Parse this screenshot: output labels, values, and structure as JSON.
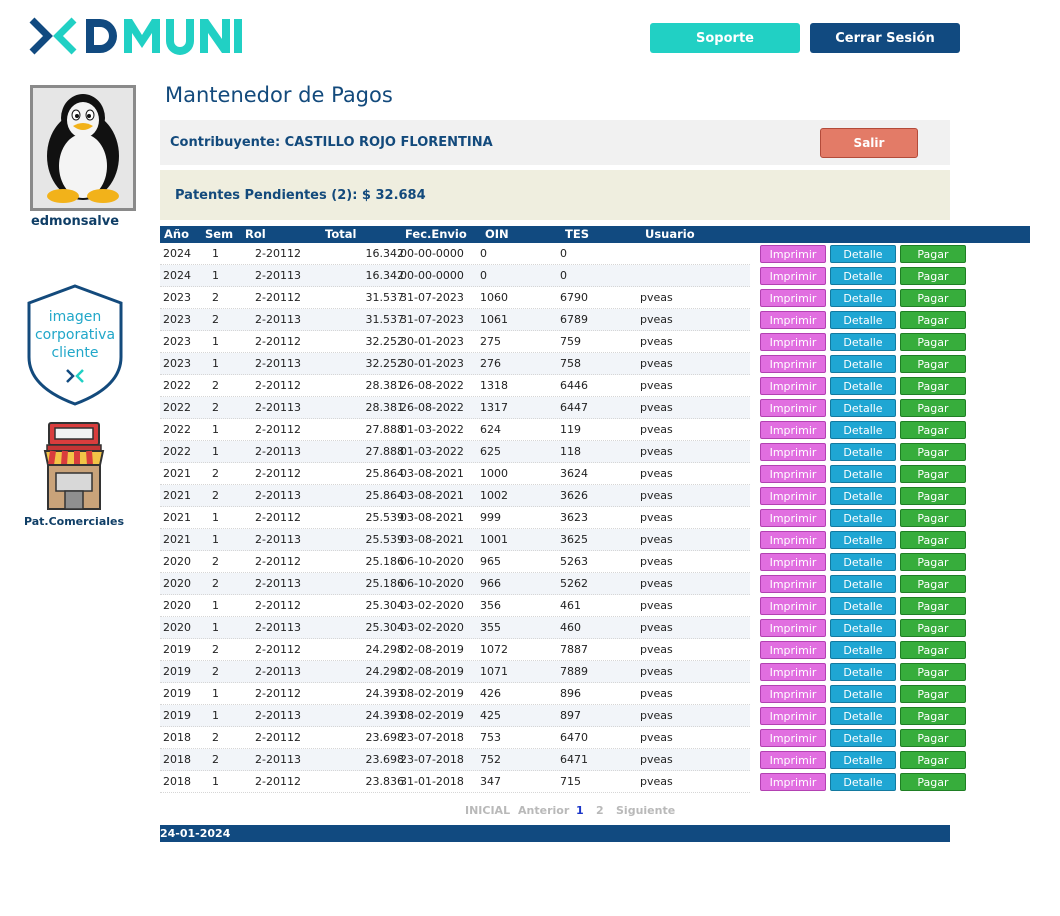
{
  "brand": {
    "logo_text": "DMUNI",
    "colors": {
      "teal": "#21d0c4",
      "navy": "#114a80"
    }
  },
  "header": {
    "support_label": "Soporte",
    "logout_label": "Cerrar Sesión"
  },
  "sidebar": {
    "username": "edmonsalve",
    "corp_image_lines": [
      "imagen",
      "corporativa",
      "cliente"
    ],
    "commercial_label": "Pat.Comerciales"
  },
  "page": {
    "title": "Mantenedor de Pagos",
    "contribuyente": "Contribuyente: CASTILLO ROJO FLORENTINA",
    "exit_label": "Salir",
    "pending": "Patentes Pendientes (2): $ 32.684"
  },
  "table": {
    "columns": [
      "Año",
      "Sem",
      "Rol",
      "Total",
      "Fec.Envio",
      "OIN",
      "TES",
      "Usuario"
    ],
    "action_labels": {
      "print": "Imprimir",
      "detail": "Detalle",
      "pay": "Pagar"
    },
    "rows": [
      [
        "2024",
        "1",
        "2-20112",
        "16.342",
        "00-00-0000",
        "0",
        "0",
        ""
      ],
      [
        "2024",
        "1",
        "2-20113",
        "16.342",
        "00-00-0000",
        "0",
        "0",
        ""
      ],
      [
        "2023",
        "2",
        "2-20112",
        "31.537",
        "31-07-2023",
        "1060",
        "6790",
        "pveas"
      ],
      [
        "2023",
        "2",
        "2-20113",
        "31.537",
        "31-07-2023",
        "1061",
        "6789",
        "pveas"
      ],
      [
        "2023",
        "1",
        "2-20112",
        "32.252",
        "30-01-2023",
        "275",
        "759",
        "pveas"
      ],
      [
        "2023",
        "1",
        "2-20113",
        "32.252",
        "30-01-2023",
        "276",
        "758",
        "pveas"
      ],
      [
        "2022",
        "2",
        "2-20112",
        "28.381",
        "26-08-2022",
        "1318",
        "6446",
        "pveas"
      ],
      [
        "2022",
        "2",
        "2-20113",
        "28.381",
        "26-08-2022",
        "1317",
        "6447",
        "pveas"
      ],
      [
        "2022",
        "1",
        "2-20112",
        "27.888",
        "01-03-2022",
        "624",
        "119",
        "pveas"
      ],
      [
        "2022",
        "1",
        "2-20113",
        "27.888",
        "01-03-2022",
        "625",
        "118",
        "pveas"
      ],
      [
        "2021",
        "2",
        "2-20112",
        "25.864",
        "03-08-2021",
        "1000",
        "3624",
        "pveas"
      ],
      [
        "2021",
        "2",
        "2-20113",
        "25.864",
        "03-08-2021",
        "1002",
        "3626",
        "pveas"
      ],
      [
        "2021",
        "1",
        "2-20112",
        "25.539",
        "03-08-2021",
        "999",
        "3623",
        "pveas"
      ],
      [
        "2021",
        "1",
        "2-20113",
        "25.539",
        "03-08-2021",
        "1001",
        "3625",
        "pveas"
      ],
      [
        "2020",
        "2",
        "2-20112",
        "25.186",
        "06-10-2020",
        "965",
        "5263",
        "pveas"
      ],
      [
        "2020",
        "2",
        "2-20113",
        "25.186",
        "06-10-2020",
        "966",
        "5262",
        "pveas"
      ],
      [
        "2020",
        "1",
        "2-20112",
        "25.304",
        "03-02-2020",
        "356",
        "461",
        "pveas"
      ],
      [
        "2020",
        "1",
        "2-20113",
        "25.304",
        "03-02-2020",
        "355",
        "460",
        "pveas"
      ],
      [
        "2019",
        "2",
        "2-20112",
        "24.298",
        "02-08-2019",
        "1072",
        "7887",
        "pveas"
      ],
      [
        "2019",
        "2",
        "2-20113",
        "24.298",
        "02-08-2019",
        "1071",
        "7889",
        "pveas"
      ],
      [
        "2019",
        "1",
        "2-20112",
        "24.393",
        "08-02-2019",
        "426",
        "896",
        "pveas"
      ],
      [
        "2019",
        "1",
        "2-20113",
        "24.393",
        "08-02-2019",
        "425",
        "897",
        "pveas"
      ],
      [
        "2018",
        "2",
        "2-20112",
        "23.698",
        "23-07-2018",
        "753",
        "6470",
        "pveas"
      ],
      [
        "2018",
        "2",
        "2-20113",
        "23.698",
        "23-07-2018",
        "752",
        "6471",
        "pveas"
      ],
      [
        "2018",
        "1",
        "2-20112",
        "23.836",
        "31-01-2018",
        "347",
        "715",
        "pveas"
      ]
    ]
  },
  "pagination": {
    "first": "INICIAL",
    "prev": "Anterior",
    "page1": "1",
    "page2": "2",
    "next": "Siguiente",
    "current": 1
  },
  "footer": {
    "date": "24-01-2024"
  }
}
